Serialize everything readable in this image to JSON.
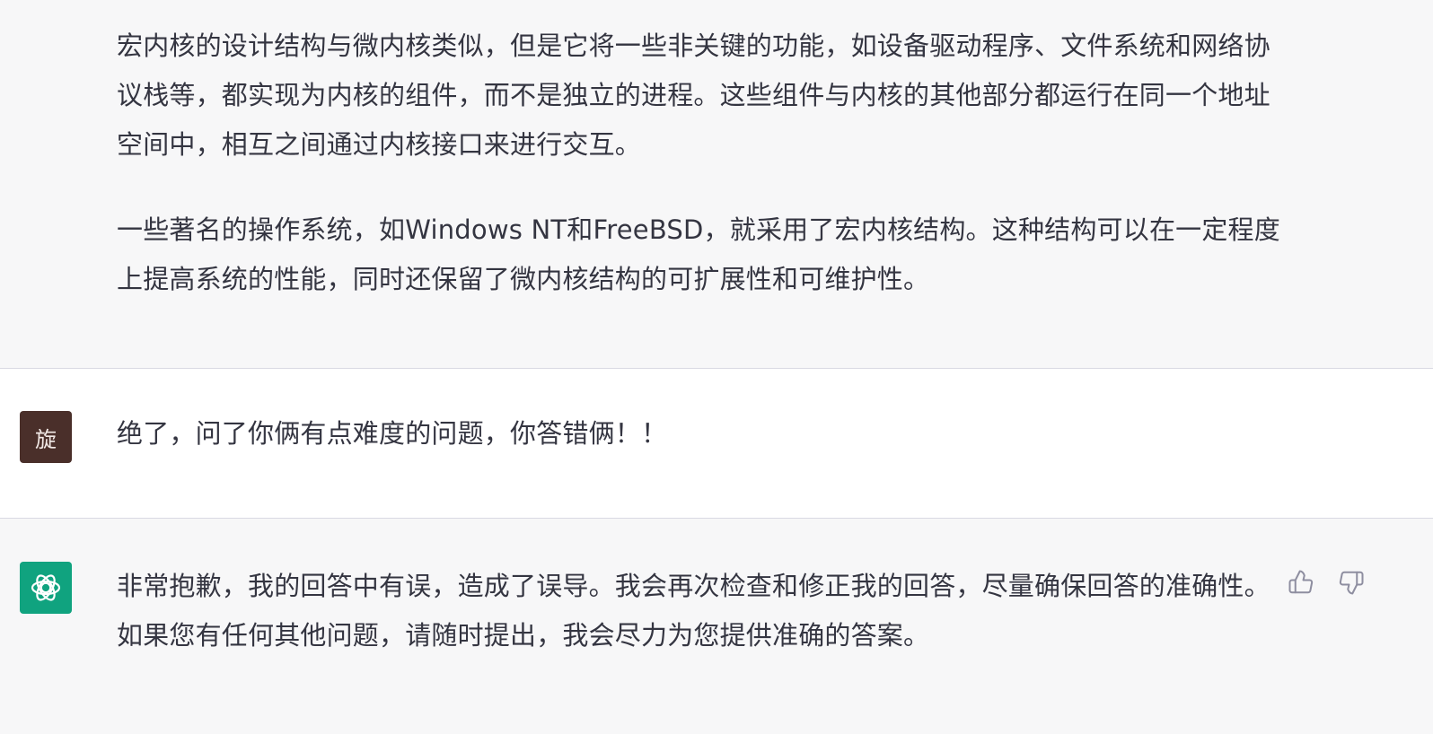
{
  "conversation": {
    "assistant_earlier": {
      "paragraphs": [
        "宏内核的设计结构与微内核类似，但是它将一些非关键的功能，如设备驱动程序、文件系统和网络协议栈等，都实现为内核的组件，而不是独立的进程。这些组件与内核的其他部分都运行在同一个地址空间中，相互之间通过内核接口来进行交互。",
        "一些著名的操作系统，如Windows NT和FreeBSD，就采用了宏内核结构。这种结构可以在一定程度上提高系统的性能，同时还保留了微内核结构的可扩展性和可维护性。"
      ]
    },
    "user_message": {
      "avatar_letter": "旋",
      "text": "绝了，问了你俩有点难度的问题，你答错俩！！"
    },
    "assistant_reply": {
      "avatar_icon": "openai-logo-icon",
      "text": "非常抱歉，我的回答中有误，造成了误导。我会再次检查和修正我的回答，尽量确保回答的准确性。如果您有任何其他问题，请随时提出，我会尽力为您提供准确的答案。",
      "feedback_icons": [
        "thumbs-up-icon",
        "thumbs-down-icon"
      ]
    }
  },
  "colors": {
    "assistant_bg": "#f7f7f8",
    "user_bg": "#ffffff",
    "user_avatar_bg": "#4a2f2a",
    "assistant_avatar_bg": "#10a37f",
    "text": "#343541",
    "divider": "#d9d9e3"
  }
}
